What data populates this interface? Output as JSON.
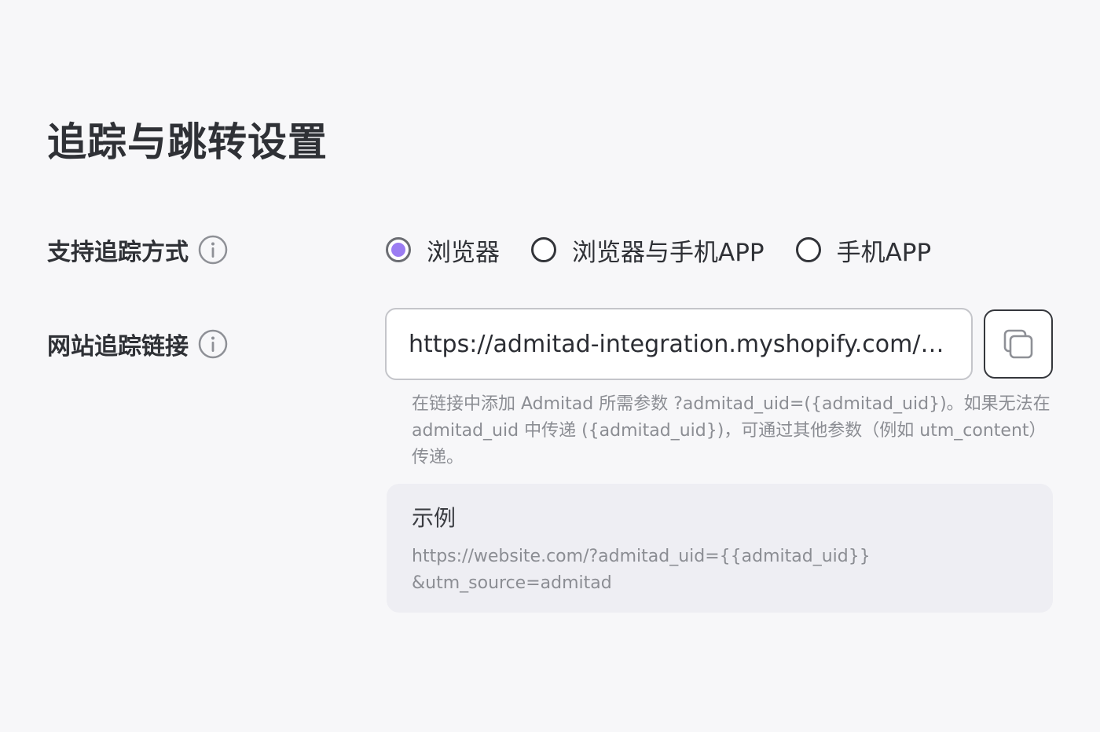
{
  "page": {
    "title": "追踪与跳转设置"
  },
  "tracking_method": {
    "label": "支持追踪方式",
    "info_icon": "info-icon",
    "options": [
      {
        "label": "浏览器",
        "selected": true
      },
      {
        "label": "浏览器与手机APP",
        "selected": false
      },
      {
        "label": "手机APP",
        "selected": false
      }
    ],
    "accent_color": "#9b7cf2"
  },
  "tracking_link": {
    "label": "网站追踪链接",
    "info_icon": "info-icon",
    "value": "https://admitad-integration.myshopify.com/?utm_source=admitad",
    "copy_icon": "copy-icon",
    "hint": "在链接中添加 Admitad 所需参数 ?admitad_uid=({admitad_uid})。如果无法在 admitad_uid 中传递 ({admitad_uid})，可通过其他参数（例如 utm_content）传递。"
  },
  "example": {
    "title": "示例",
    "line1": "https://website.com/?admitad_uid={{admitad_uid}}",
    "line2": "&utm_source=admitad"
  }
}
